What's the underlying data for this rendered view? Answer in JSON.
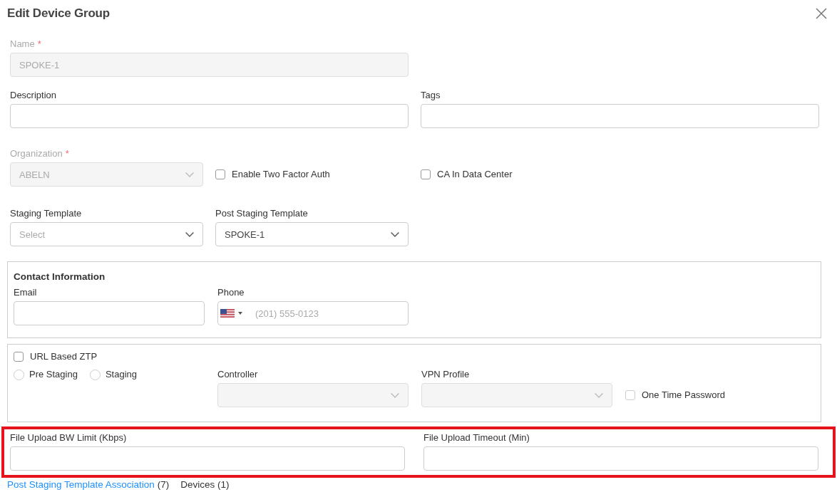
{
  "title": "Edit Device Group",
  "name_field": {
    "label": "Name",
    "required_mark": "*",
    "label_greyed": true,
    "value": "SPOKE-1",
    "disabled": true
  },
  "description_field": {
    "label": "Description"
  },
  "tags_field": {
    "label": "Tags"
  },
  "organization_field": {
    "label": "Organization",
    "required_mark": "*",
    "label_greyed": true,
    "value": "ABELN",
    "disabled": true
  },
  "options": [
    {
      "label": "Enable Two Factor Auth",
      "checked": false
    },
    {
      "label": "CA In Data Center",
      "checked": false
    }
  ],
  "staging_template": {
    "label": "Staging Template",
    "placeholder": "Select"
  },
  "post_staging_template": {
    "label": "Post Staging Template",
    "value": "SPOKE-1"
  },
  "contact": {
    "heading": "Contact Information",
    "email": {
      "label": "Email"
    },
    "phone": {
      "label": "Phone",
      "placeholder": "(201) 555-0123"
    }
  },
  "ztp": {
    "url_based": {
      "label": "URL Based ZTP",
      "checked": false
    },
    "modes": [
      {
        "label": "Pre Staging",
        "selected": false
      },
      {
        "label": "Staging",
        "selected": false
      }
    ],
    "controller": {
      "label": "Controller",
      "disabled": true
    },
    "vpn_profile": {
      "label": "VPN Profile",
      "disabled": true
    },
    "one_time_password": {
      "label": "One Time Password",
      "checked": false,
      "disabled": true
    }
  },
  "upload": {
    "highlighted": true,
    "fields": [
      {
        "label": "File Upload BW Limit (Kbps)"
      },
      {
        "label": "File Upload Timeout (Min)"
      }
    ]
  },
  "tabs": [
    {
      "label": "Post Staging Template Association",
      "count": "(7)",
      "selected": true
    },
    {
      "label": "Devices",
      "count": "(1)",
      "selected": false
    }
  ]
}
